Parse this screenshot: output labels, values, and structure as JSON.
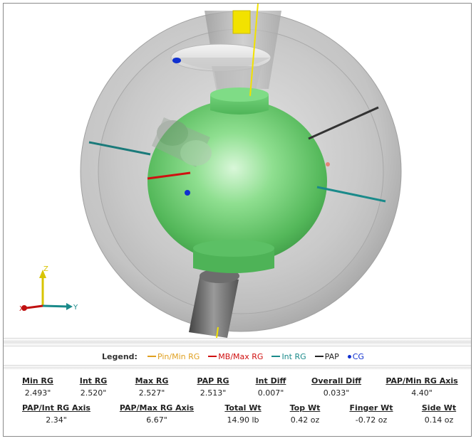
{
  "viewport": {
    "axis_labels": {
      "z": "Z",
      "x": "X",
      "y": "Y"
    }
  },
  "legend": {
    "title": "Legend:",
    "items": [
      {
        "label": "Pin/Min RG",
        "color": "#e0a020",
        "kind": "line"
      },
      {
        "label": "MB/Max RG",
        "color": "#d01010",
        "kind": "line"
      },
      {
        "label": "Int RG",
        "color": "#1a8a8a",
        "kind": "line"
      },
      {
        "label": "PAP",
        "color": "#222222",
        "kind": "line"
      },
      {
        "label": "CG",
        "color": "#1030d0",
        "kind": "dot"
      }
    ]
  },
  "stats": {
    "min_rg": {
      "label": "Min RG",
      "value": "2.493\""
    },
    "int_rg": {
      "label": "Int RG",
      "value": "2.520\""
    },
    "max_rg": {
      "label": "Max RG",
      "value": "2.527\""
    },
    "pap_rg": {
      "label": "PAP RG",
      "value": "2.513\""
    },
    "int_diff": {
      "label": "Int Diff",
      "value": "0.007\""
    },
    "overall_diff": {
      "label": "Overall Diff",
      "value": "0.033\""
    },
    "pap_min_rg_axis": {
      "label": "PAP/Min RG Axis",
      "value": "4.40\""
    },
    "pap_int_rg_axis": {
      "label": "PAP/Int RG Axis",
      "value": "2.34\""
    },
    "pap_max_rg_axis": {
      "label": "PAP/Max RG Axis",
      "value": "6.67\""
    },
    "total_wt": {
      "label": "Total Wt",
      "value": "14.90 lb"
    },
    "top_wt": {
      "label": "Top Wt",
      "value": "0.42 oz"
    },
    "finger_wt": {
      "label": "Finger Wt",
      "value": "-0.72 oz"
    },
    "side_wt": {
      "label": "Side Wt",
      "value": "0.14 oz"
    }
  }
}
